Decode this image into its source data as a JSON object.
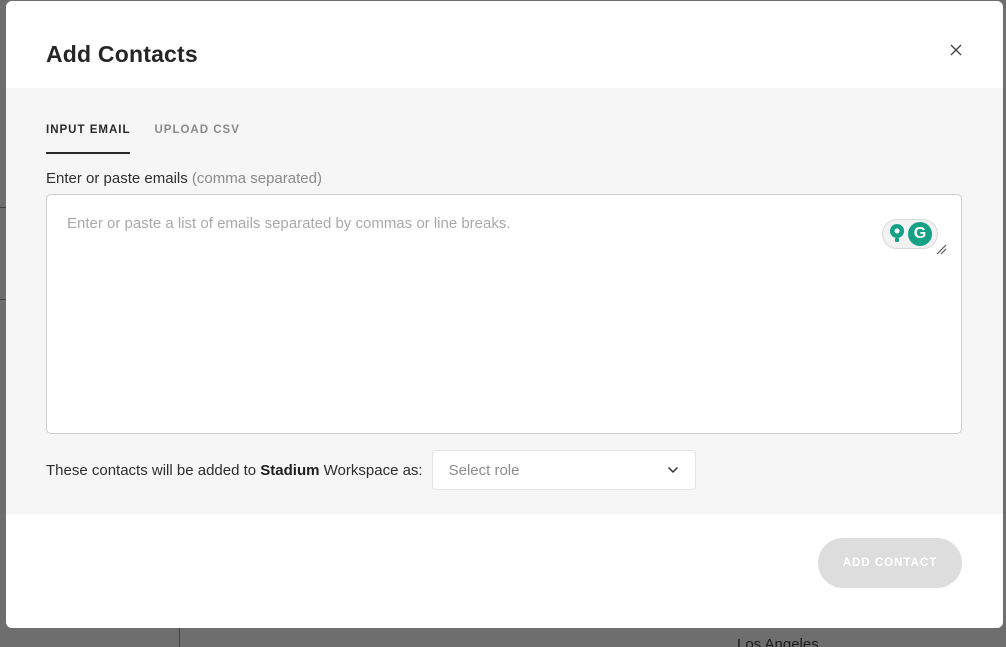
{
  "modal": {
    "title": "Add Contacts",
    "tabs": [
      {
        "label": "INPUT EMAIL",
        "active": true
      },
      {
        "label": "UPLOAD CSV",
        "active": false
      }
    ],
    "email_label": "Enter or paste emails",
    "email_label_hint": "(comma separated)",
    "email_placeholder": "Enter or paste a list of emails separated by commas or line breaks.",
    "email_value": "",
    "role_prefix": "These contacts will be added to",
    "workspace_name": "Stadium",
    "role_suffix": "Workspace as:",
    "role_select_placeholder": "Select role",
    "submit_label": "ADD CONTACT"
  },
  "background": {
    "location_text": "Los Angeles"
  },
  "colors": {
    "grammarly_green": "#15a185",
    "disabled_button": "#dddddd",
    "body_background": "#f5f6f5"
  }
}
